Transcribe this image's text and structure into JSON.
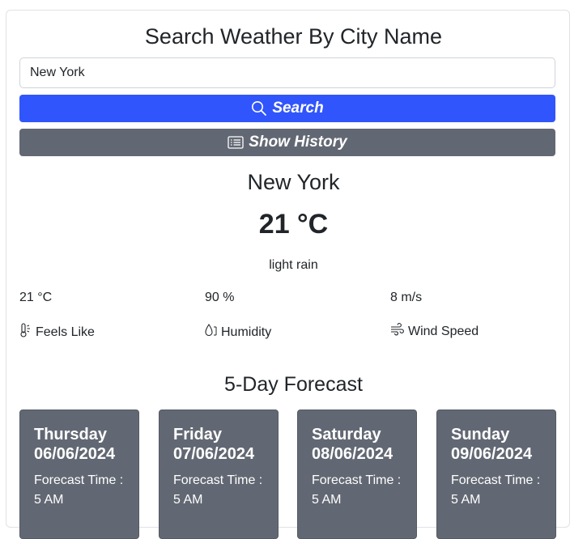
{
  "header": {
    "title": "Search Weather By City Name"
  },
  "search": {
    "value": "New York",
    "button_label": "Search",
    "history_label": "Show History"
  },
  "current": {
    "city": "New York",
    "temperature": "21 °C",
    "description": "light rain",
    "feels_like_value": "21 °C",
    "humidity_value": "90 %",
    "wind_value": "8 m/s",
    "feels_like_label": "Feels Like",
    "humidity_label": "Humidity",
    "wind_label": "Wind Speed"
  },
  "forecast": {
    "title": "5-Day Forecast",
    "days": [
      {
        "day": "Thursday",
        "date": "06/06/2024",
        "time_label": "Forecast Time :",
        "time": "5 AM"
      },
      {
        "day": "Friday",
        "date": "07/06/2024",
        "time_label": "Forecast Time :",
        "time": "5 AM"
      },
      {
        "day": "Saturday",
        "date": "08/06/2024",
        "time_label": "Forecast Time :",
        "time": "5 AM"
      },
      {
        "day": "Sunday",
        "date": "09/06/2024",
        "time_label": "Forecast Time :",
        "time": "5 AM"
      }
    ]
  },
  "colors": {
    "primary": "#3155fc",
    "secondary": "#626873"
  },
  "icons": [
    "search-icon",
    "list-icon",
    "thermometer-icon",
    "humidity-icon",
    "wind-icon"
  ]
}
